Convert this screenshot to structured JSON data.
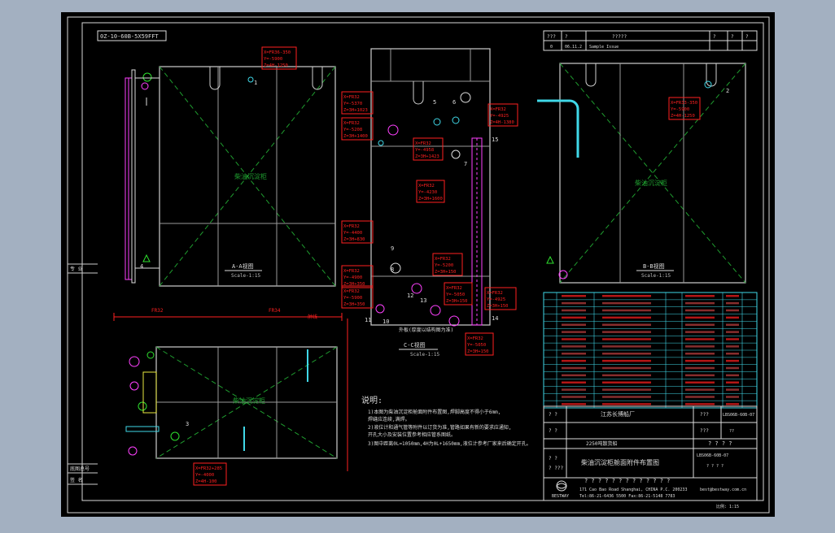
{
  "drawing_code_box": "0Z-10-60B-5X59FFT",
  "views": {
    "aa": {
      "title": "A-A视图",
      "scale": "Scale-1:15",
      "label": "柴油沉淀柜"
    },
    "bb": {
      "title": "B-B视图",
      "scale": "Scale-1:15",
      "label": "柴油沉淀柜"
    },
    "cc": {
      "title": "C-C视图",
      "scale": "Scale-1:15"
    },
    "plan": {
      "label": "柴油沉淀柜",
      "fr_left": "FR32",
      "fr_right": "FR34",
      "dim_note": "舯线"
    }
  },
  "callouts": [
    {
      "id": "c1",
      "lines": [
        "X=FR36-350",
        "Y=-5900",
        "Z=4H-1250"
      ]
    },
    {
      "id": "c2",
      "lines": [
        "X=FR32",
        "Y=-5370",
        "Z=3H+1023"
      ]
    },
    {
      "id": "c3",
      "lines": [
        "X=FR32",
        "Y=-5208",
        "Z=3H+1400"
      ]
    },
    {
      "id": "c4",
      "lines": [
        "X=FR32",
        "Y=-4958",
        "Z=3H+1423"
      ]
    },
    {
      "id": "c5",
      "lines": [
        "X=FR32",
        "Y=-4925",
        "Z=4H-1380"
      ]
    },
    {
      "id": "c6",
      "lines": [
        "X=FR32",
        "Y=-4230",
        "Z=3H+1600"
      ]
    },
    {
      "id": "c7",
      "lines": [
        "X=FR32",
        "Y=-4400",
        "Z=3H+830"
      ]
    },
    {
      "id": "c8",
      "lines": [
        "X=FR32",
        "Y=-4900",
        "Z=3H+350"
      ]
    },
    {
      "id": "c9",
      "lines": [
        "X=FR32",
        "Y=-5900",
        "Z=3H+350"
      ]
    },
    {
      "id": "c10",
      "lines": [
        "X=FR32",
        "Y=-5200",
        "Z=3H+150"
      ]
    },
    {
      "id": "c11",
      "lines": [
        "X=FR32",
        "Y=-5050",
        "Z=3H+150"
      ]
    },
    {
      "id": "c12",
      "lines": [
        "X=FR32",
        "Y=-4925",
        "Z=3H+150"
      ]
    },
    {
      "id": "c13",
      "lines": [
        "X=FR32",
        "Y=-5050",
        "Z=3H+150"
      ]
    },
    {
      "id": "c14",
      "lines": [
        "X=FR33-350",
        "Y=-5900",
        "Z=4H-1250"
      ]
    },
    {
      "id": "c15",
      "lines": [
        "X=FR32+285",
        "Y=-4000",
        "Z=4H-100"
      ]
    }
  ],
  "item_numbers": [
    "1",
    "2",
    "3",
    "4",
    "5",
    "6",
    "7",
    "8",
    "9",
    "10",
    "11",
    "12",
    "13",
    "14",
    "15"
  ],
  "notes": {
    "title": "说明:",
    "lines": [
      "1)本图为柴油沉淀柜舱面附件布置图,焊脚高度不得小于6mm,",
      "   焊缝应连续,满焊。",
      "2)液位计和通气管等附件以订货为准,管路如果有新的要求应通知,",
      "   开孔大小及安装位置参考相应管系图纸。",
      "3)图中距离0L=1050mm,4H为0L+1650mm,液位计参考厂家来后确定开孔。"
    ]
  },
  "sheet_edge": {
    "left_top": "专  业",
    "left_mid": "底图总号",
    "left_bot": "签  名"
  },
  "title_block": {
    "rev_header": [
      "???",
      "?",
      "?????",
      "?",
      "?",
      "?"
    ],
    "rev_row": [
      "0",
      "06.11.2",
      "Sample Issue"
    ],
    "company": "江苏长博船厂",
    "project": "2250吨散货船",
    "drawing_name": "柴油沉淀柜舱面附件布置图",
    "drawing_no": "LBS06B-60B-07",
    "sheet": "??",
    "q_marks": "? ? ? ? ? ? ? ? ? ? ? ? ?",
    "address_line1": "171 Cao Bao Road Shanghai, CHINA  P.C. 200233",
    "address_line2": "Tel:86-21-6436 5500  Fax:86-21-5148 7783",
    "email": "best@bestway.com.cn",
    "logo_text": "BESTWAY",
    "scale_label": "比例: 1:15"
  },
  "bom_rows": 16,
  "colors": {
    "bg": "#a3b0c1",
    "sheet": "#000000",
    "red": "#ff2020",
    "white": "#e8e8e8",
    "green": "#1f9d2f",
    "cyan": "#40d8e8",
    "magenta": "#ff40ff",
    "yellow": "#e8e840"
  }
}
